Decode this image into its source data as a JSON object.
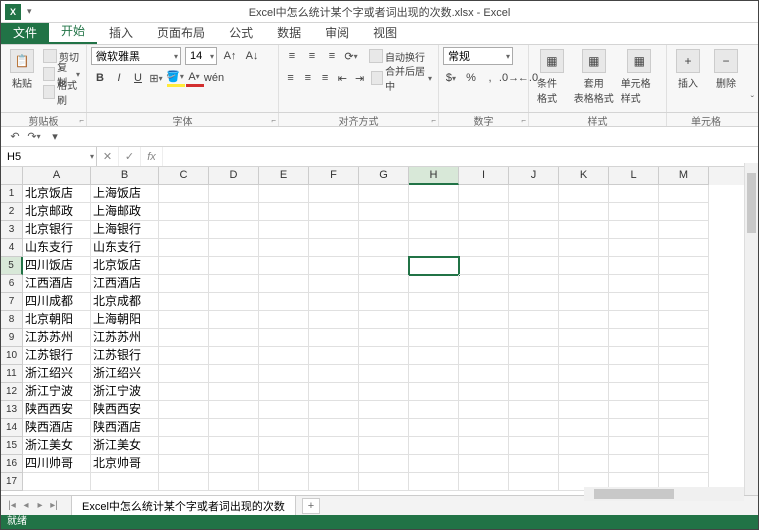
{
  "title": "Excel中怎么统计某个字或者词出现的次数.xlsx - Excel",
  "tabs": {
    "file": "文件",
    "home": "开始",
    "insert": "插入",
    "layout": "页面布局",
    "formulas": "公式",
    "data": "数据",
    "review": "审阅",
    "view": "视图"
  },
  "ribbon": {
    "clipboard": {
      "paste": "粘贴",
      "cut": "剪切",
      "copy": "复制",
      "format_painter": "格式刷",
      "label": "剪贴板"
    },
    "font": {
      "name": "微软雅黑",
      "size": "14",
      "label": "字体"
    },
    "align": {
      "wrap": "自动换行",
      "merge": "合并后居中",
      "label": "对齐方式"
    },
    "number": {
      "format": "常规",
      "label": "数字"
    },
    "styles": {
      "cond": "条件格式",
      "table": "套用\n表格格式",
      "cell": "单元格样式",
      "label": "样式"
    },
    "cells": {
      "insert": "插入",
      "delete": "删除",
      "label": "单元格"
    }
  },
  "namebox": "H5",
  "columns": [
    "A",
    "B",
    "C",
    "D",
    "E",
    "F",
    "G",
    "H",
    "I",
    "J",
    "K",
    "L",
    "M"
  ],
  "active": {
    "row": 5,
    "col": "H"
  },
  "data_rows": [
    [
      "北京饭店",
      "上海饭店"
    ],
    [
      "北京邮政",
      "上海邮政"
    ],
    [
      "北京银行",
      "上海银行"
    ],
    [
      "山东支行",
      "山东支行"
    ],
    [
      "四川饭店",
      "北京饭店"
    ],
    [
      "江西酒店",
      "江西酒店"
    ],
    [
      "四川成都",
      "北京成都"
    ],
    [
      "北京朝阳",
      "上海朝阳"
    ],
    [
      "江苏苏州",
      "江苏苏州"
    ],
    [
      "江苏银行",
      "江苏银行"
    ],
    [
      "浙江绍兴",
      "浙江绍兴"
    ],
    [
      "浙江宁波",
      "浙江宁波"
    ],
    [
      "陕西西安",
      "陕西西安"
    ],
    [
      "陕西酒店",
      "陕西酒店"
    ],
    [
      "浙江美女",
      "浙江美女"
    ],
    [
      "四川帅哥",
      "北京帅哥"
    ]
  ],
  "sheet_tab": "Excel中怎么统计某个字或者词出现的次数",
  "status": "就绪"
}
